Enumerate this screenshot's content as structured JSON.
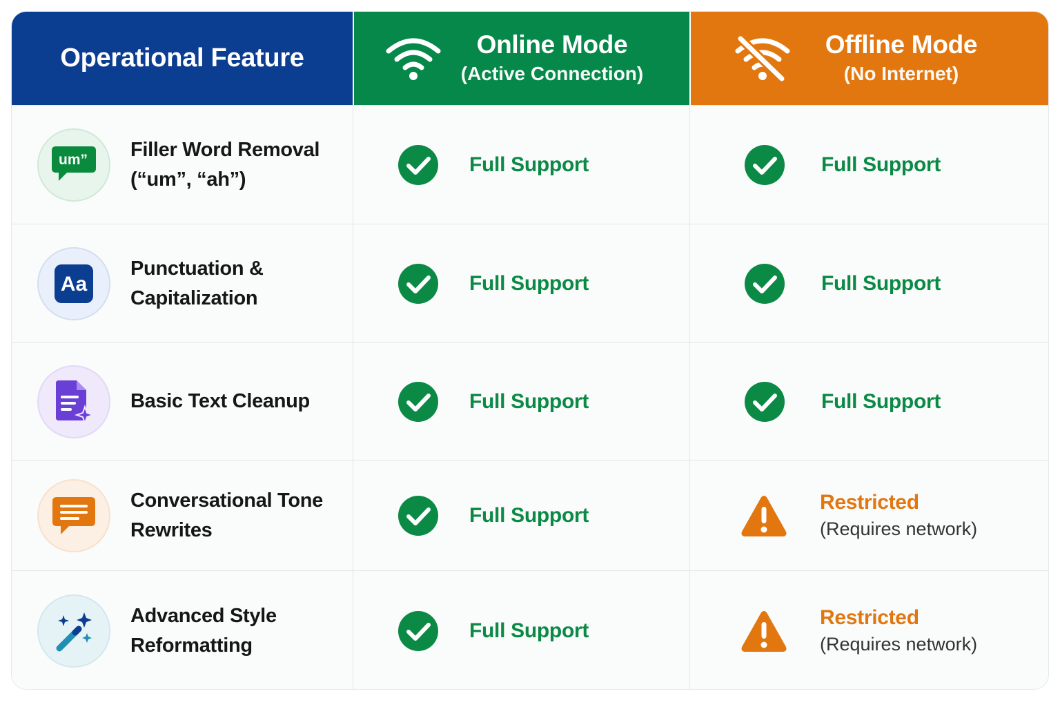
{
  "colors": {
    "feature_header": "#0b3d91",
    "online_header": "#06884a",
    "offline_header": "#e3770f",
    "full_support": "#0b8a45",
    "restricted": "#e3770f"
  },
  "header": {
    "feature": "Operational Feature",
    "online": {
      "title": "Online Mode",
      "subtitle": "(Active Connection)",
      "icon": "wifi-icon"
    },
    "offline": {
      "title": "Offline Mode",
      "subtitle": "(No Internet)",
      "icon": "wifi-off-icon"
    }
  },
  "rows": [
    {
      "feature": "Filler Word Removal (“um”, “ah”)",
      "icon": "speech-bubble-um-icon",
      "icon_text": "um”",
      "online": {
        "label": "Full Support",
        "status": "full"
      },
      "offline": {
        "label": "Full Support",
        "status": "full"
      }
    },
    {
      "feature": "Punctuation & Capitalization",
      "icon": "text-case-icon",
      "icon_text": "Aa",
      "online": {
        "label": "Full Support",
        "status": "full"
      },
      "offline": {
        "label": "Full Support",
        "status": "full"
      }
    },
    {
      "feature": "Basic Text Cleanup",
      "icon": "document-sparkle-icon",
      "online": {
        "label": "Full Support",
        "status": "full"
      },
      "offline": {
        "label": "Full Support",
        "status": "full"
      }
    },
    {
      "feature": "Conversational Tone Rewrites",
      "icon": "chat-lines-icon",
      "online": {
        "label": "Full Support",
        "status": "full"
      },
      "offline": {
        "label": "Restricted",
        "note": "(Requires network)",
        "status": "restricted"
      }
    },
    {
      "feature": "Advanced Style Reformatting",
      "icon": "magic-wand-icon",
      "online": {
        "label": "Full Support",
        "status": "full"
      },
      "offline": {
        "label": "Restricted",
        "note": "(Requires network)",
        "status": "restricted"
      }
    }
  ]
}
